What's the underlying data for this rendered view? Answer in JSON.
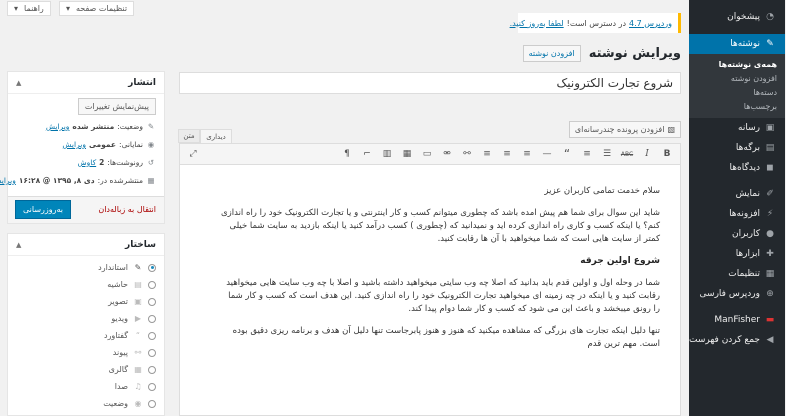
{
  "sidebar": {
    "dashboard": "پیشخوان",
    "posts": "نوشته‌ها",
    "posts_sub": [
      "همه‌ی نوشته‌ها",
      "افزودن نوشته",
      "دسته‌ها",
      "برچسب‌ها"
    ],
    "media": "رسانه",
    "pages": "برگه‌ها",
    "comments": "دیدگاه‌ها",
    "appearance": "نمایش",
    "plugins": "افزونه‌ها",
    "users": "کاربران",
    "tools": "ابزارها",
    "settings": "تنظیمات",
    "wp_farsi": "وردپرس فارسی",
    "manfisher": "ManFisher",
    "collapse": "جمع کردن فهرست"
  },
  "top": {
    "screen_options": "تنظیمات صفحه",
    "help": "راهنما"
  },
  "notice": {
    "version_link": "وردپرس 4.7",
    "text": "در دسترس است!",
    "update_link": "لطفا به‌روز کنید."
  },
  "page_title": "ویرایش نوشته",
  "add_new": "افزودن نوشته",
  "post_title": "شروع تجارت الکترونیک",
  "editor": {
    "add_media": "افزودن پرونده چندرسانه‌ای",
    "tab_visual": "دیداری",
    "tab_text": "متن",
    "content": {
      "p1": "سلام خدمت تمامی کاربران عزیز",
      "p2": "شاید این سوال برای شما هم پیش امده باشد که چطوری میتوانم کسب و کار اینترنتی و یا تجارت الکترونیک خود را راه اندازی کنم؟ یا اینکه کسب و کاری راه اندازی کرده اید و نمیدانید که (چطوری ) کسب درآمد کنید یا اینکه بازدید به سایت شما خیلی کمتر از سایت هایی است که شما میخواهید با آن ها رقابت کنید.",
      "h1": "شروع اولین جرقه",
      "p3": "شما در وحله اول و اولین قدم باید بدانید که اصلا چه وب سایتی میخواهید داشته باشید و اصلا با چه وب سایت هایی میخواهید رقابت کنید و یا اینکه در چه زمینه ای میخواهید تجارت الکترونیک خود را راه اندازی کنید. این هدف است که کسب و کار شما را رونق میبخشد و باعث این می شود که کسب و کار شما دوام پیدا کند.",
      "p4": "تنها دلیل اینکه تجارت های بزرگی که مشاهده میکنید که هنوز و هنوز پابرجاست تنها دلیل آن هدف و برنامه ریزی دقیق بوده است. مهم ترین قدم"
    }
  },
  "publish": {
    "title": "انتشار",
    "preview": "پیش‌نمایش تغییرات",
    "status_label": "وضعیت:",
    "status_value": "منتشر شده",
    "visibility_label": "نمایانی:",
    "visibility_value": "عمومی",
    "revisions_label": "رونوشت‌ها:",
    "revisions_value": "2",
    "browse": "کاوش",
    "published_label": "منتشرشده در:",
    "published_value": "دی ۸, ۱۳۹۵ @ ۱۶:۲۸",
    "edit": "ویرایش",
    "trash": "انتقال به زباله‌دان",
    "update": "به‌روزرسانی"
  },
  "format": {
    "title": "ساختار",
    "options": [
      "استاندارد",
      "حاشیه",
      "تصویر",
      "ویدیو",
      "گفتاورد",
      "پیوند",
      "گالری",
      "صدا",
      "وضعیت"
    ],
    "selected": "استاندارد"
  },
  "colors": {
    "sidebar": "#23282d",
    "accent": "#0073aa",
    "notice_border": "#ffb900",
    "primary_button": "#0085ba"
  }
}
